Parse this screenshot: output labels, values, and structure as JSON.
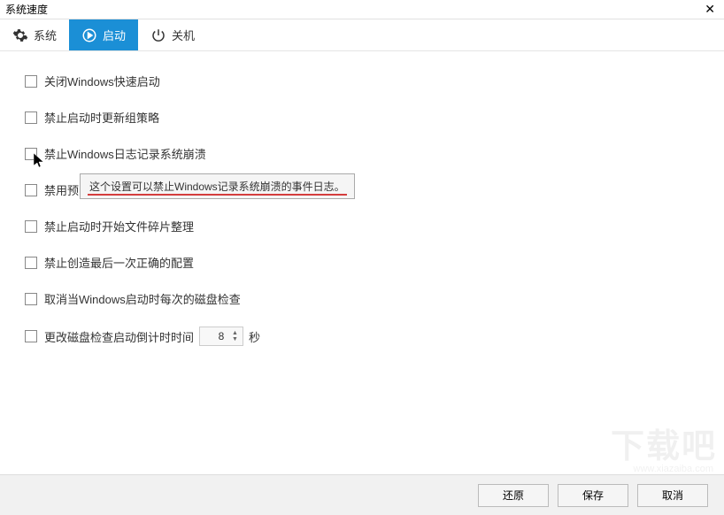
{
  "titlebar": {
    "title": "系统速度"
  },
  "tabs": {
    "system": "系统",
    "startup": "启动",
    "shutdown": "关机"
  },
  "options": {
    "close_fast_startup": "关闭Windows快速启动",
    "disable_gp_update": "禁止启动时更新组策略",
    "disable_crash_log": "禁止Windows日志记录系统崩溃",
    "disable_prefetch_prefix": "禁用预",
    "disable_defrag": "禁止启动时开始文件碎片整理",
    "disable_last_config": "禁止创造最后一次正确的配置",
    "cancel_disk_check": "取消当Windows启动时每次的磁盘检查",
    "change_countdown": "更改磁盘检查启动倒计时时间",
    "countdown_value": "8",
    "seconds_suffix": "秒"
  },
  "tooltip": {
    "text": "这个设置可以禁止Windows记录系统崩溃的事件日志。"
  },
  "footer": {
    "restore": "还原",
    "save": "保存",
    "cancel": "取消"
  },
  "watermark": {
    "main": "下载吧",
    "sub": "www.xiazaiba.com"
  }
}
